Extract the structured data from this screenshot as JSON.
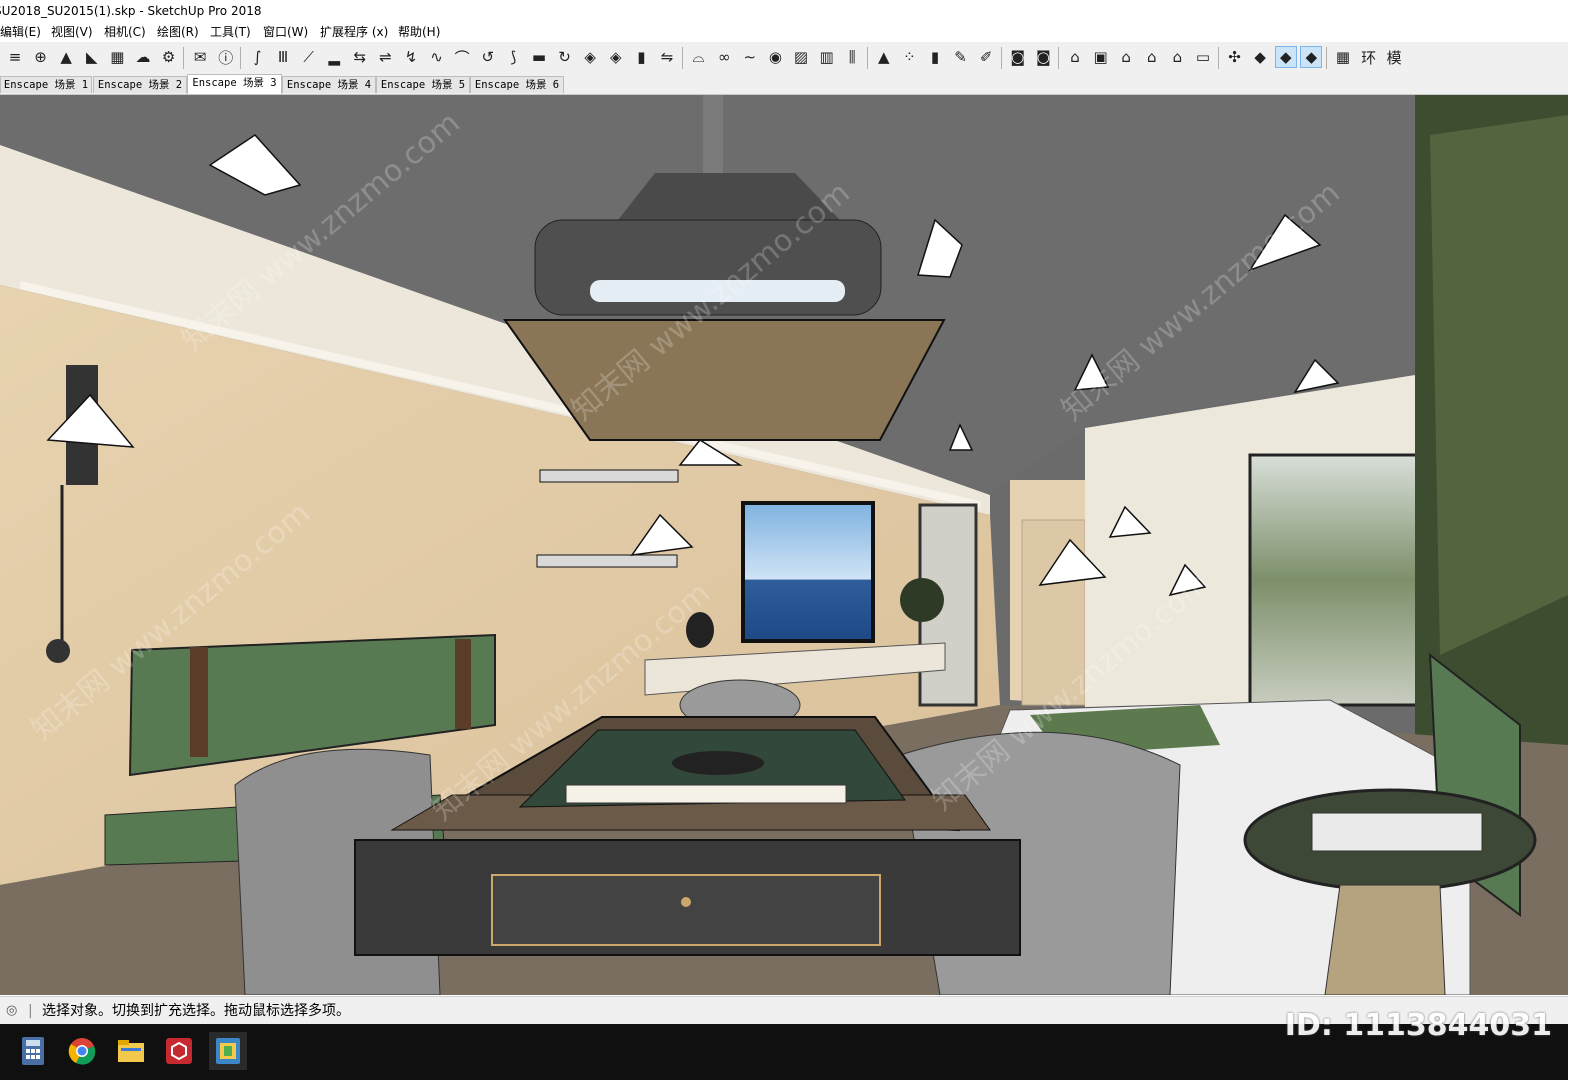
{
  "window": {
    "title": "SU2018_SU2015(1).skp - SketchUp Pro 2018"
  },
  "menu": [
    "编辑(E)",
    "视图(V)",
    "相机(C)",
    "绘图(R)",
    "工具(T)",
    "窗口(W)",
    "扩展程序 (x)",
    "帮助(H)"
  ],
  "toolbar": {
    "icons": [
      "layer-stack-icon",
      "add-circle-icon",
      "tree-icon",
      "landscape-icon",
      "checker-material-icon",
      "cloud-upload-icon",
      "gear-icon",
      "mail-icon",
      "info-icon",
      "sandbox-icon",
      "column-icon",
      "stairs-icon",
      "bar-steps-icon",
      "swap-icon",
      "line-sweep-icon",
      "curve-icon",
      "wave-icon",
      "arc-icon",
      "loop-icon",
      "path-icon",
      "tube-icon",
      "rotate-icon",
      "layer-icon",
      "layer-copy-icon",
      "door-icon",
      "flip-icon",
      "arch-icon",
      "chain-icon",
      "squiggle-icon",
      "spiral-icon",
      "hatch-icon",
      "fence-icon",
      "colonnade-icon",
      "triangle-icon",
      "grid-icon",
      "book-icon",
      "pen-icon",
      "brush-icon",
      "render-icon",
      "render-settings-icon",
      "house-front-icon",
      "box-icon",
      "home-icon",
      "roof-icon",
      "home-outline-icon",
      "garage-icon",
      "axes-icon",
      "cube-blue-icon",
      "cube-select-icon",
      "cube-move-icon",
      "table-icon",
      "ring-icon",
      "model-icon"
    ],
    "glyphs": [
      "≡",
      "⊕",
      "▲",
      "◣",
      "▦",
      "☁",
      "⚙",
      "✉",
      "ⓘ",
      "∫",
      "Ⅲ",
      "⟋",
      "▂",
      "⇆",
      "⇌",
      "↯",
      "∿",
      "⌒",
      "↺",
      "⟆",
      "▬",
      "↻",
      "◈",
      "◈",
      "▮",
      "⇋",
      "⌓",
      "∞",
      "∼",
      "◉",
      "▨",
      "▥",
      "⫼",
      "▲",
      "⁘",
      "▮",
      "✎",
      "✐",
      "◙",
      "◙",
      "⌂",
      "▣",
      "⌂",
      "⌂",
      "⌂",
      "▭",
      "✣",
      "◆",
      "◆",
      "◆",
      "▦",
      "环",
      "模"
    ]
  },
  "tabs": [
    "Enscape 场景 1",
    "Enscape 场景 2",
    "Enscape 场景 3",
    "Enscape 场景 4",
    "Enscape 场景 5",
    "Enscape 场景 6"
  ],
  "active_tab": 2,
  "status": {
    "text": "选择对象。切换到扩充选择。拖动鼠标选择多项。"
  },
  "watermark": {
    "id": "ID: 1113844031",
    "logo": "知末",
    "text": "知末网 www.znzmo.com"
  },
  "taskbar": [
    "calculator-icon",
    "chrome-icon",
    "file-explorer-icon",
    "sketchup-icon",
    "app-icon"
  ]
}
